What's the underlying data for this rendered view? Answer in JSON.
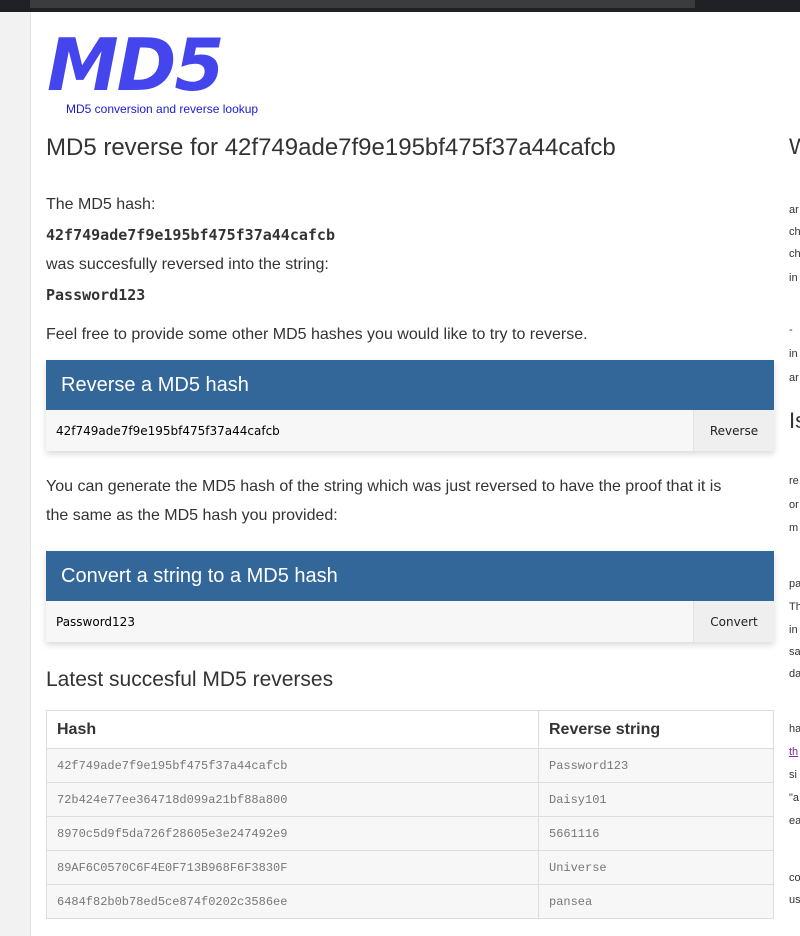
{
  "logo": {
    "text": "MD5",
    "tagline": "MD5 conversion and reverse lookup"
  },
  "page_title": "MD5 reverse for 42f749ade7f9e195bf475f37a44cafcb",
  "intro": {
    "label": "The MD5 hash:",
    "hash": "42f749ade7f9e195bf475f37a44cafcb",
    "middle": "was succesfully reversed into the string:",
    "result": "Password123",
    "footer": "Feel free to provide some other MD5 hashes you would like to try to reverse."
  },
  "reverse_panel": {
    "title": "Reverse a MD5 hash",
    "input_value": "42f749ade7f9e195bf475f37a44cafcb",
    "button_label": "Reverse"
  },
  "proof_text_line1": "You can generate the MD5 hash of the string which was just reversed to have the proof that it is",
  "proof_text_line2": "the same as the MD5 hash you provided:",
  "convert_panel": {
    "title": "Convert a string to a MD5 hash",
    "input_value": "Password123",
    "button_label": "Convert"
  },
  "latest": {
    "title": "Latest succesful MD5 reverses",
    "columns": [
      "Hash",
      "Reverse string"
    ],
    "rows": [
      [
        "42f749ade7f9e195bf475f37a44cafcb",
        "Password123"
      ],
      [
        "72b424e77ee364718d099a21bf88a800",
        "Daisy101"
      ],
      [
        "8970c5d9f5da726f28605e3e247492e9",
        "5661116"
      ],
      [
        "89AF6C0570C6F4E0F713B968F6F3830F",
        "Universe"
      ],
      [
        "6484f82b0b78ed5ce874f0202c3586ee",
        "pansea"
      ]
    ]
  },
  "sidebar_fragments": {
    "w": "W",
    "is": "Is",
    "f1": "ar",
    "f2": "ch",
    "f3": "ch",
    "f4": "in",
    "f5": "-",
    "f6": "in",
    "f7": "ar",
    "f8": "re",
    "f9": "or",
    "f10": "m",
    "f11": "pa",
    "f12": "Th",
    "f13": "in",
    "f14": "sa",
    "f15": "da",
    "f16": "ha",
    "f17": "th",
    "f18": "si",
    "f19": "\"a",
    "f20": "ea",
    "f21": "co",
    "f22": "us"
  },
  "colors": {
    "panel_header": "#336699",
    "logo": "#4545ee",
    "link": "#7a2aa0"
  }
}
